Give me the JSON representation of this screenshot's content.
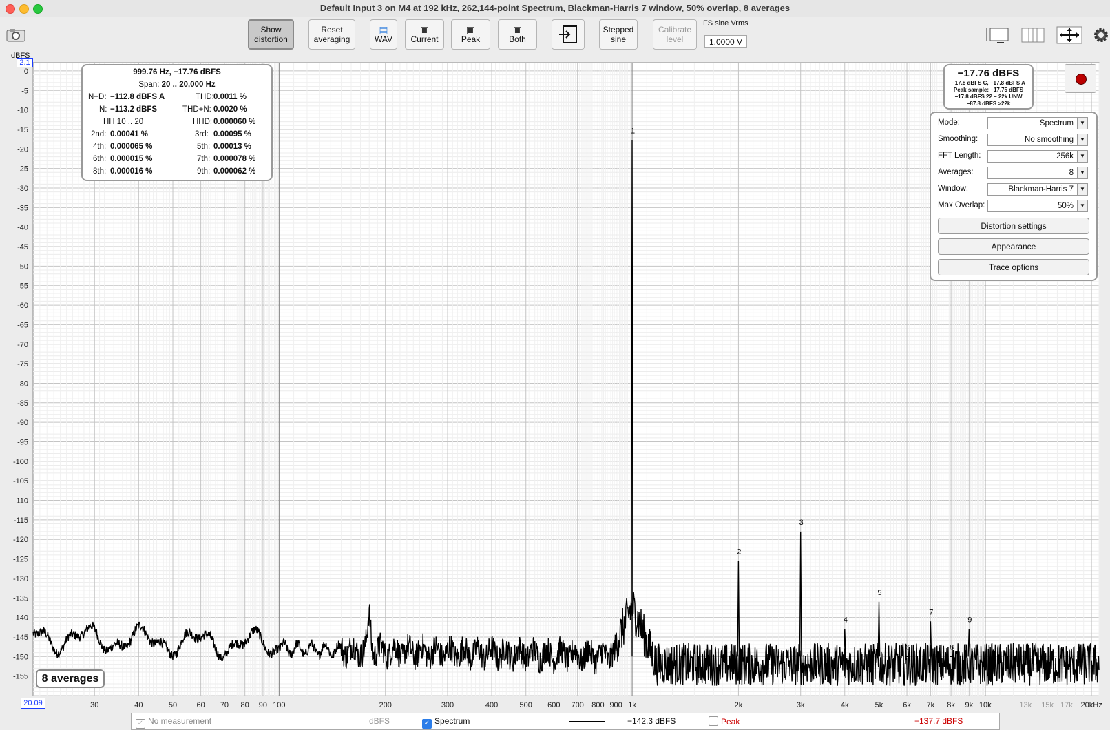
{
  "window": {
    "title": "Default Input 3 on M4 at 192 kHz, 262,144-point Spectrum, Blackman-Harris 7 window, 50% overlap, 8 averages"
  },
  "toolbar": {
    "show_distortion": [
      "Show",
      "distortion"
    ],
    "reset_averaging": [
      "Reset",
      "averaging"
    ],
    "wav": "WAV",
    "current": "Current",
    "peak": "Peak",
    "both": "Both",
    "stepped_sine": [
      "Stepped",
      "sine"
    ],
    "calibrate_level": [
      "Calibrate",
      "level"
    ],
    "fs_label": "FS sine Vrms",
    "fs_value": "1.0000 V"
  },
  "distortion": {
    "header": "999.76 Hz, −17.76 dBFS",
    "span_label": "Span:",
    "span": "20 .. 20,000 Hz",
    "rows": [
      [
        "N+D:",
        "−112.8 dBFS A",
        "THD:",
        "0.0011 %"
      ],
      [
        "N:",
        "−113.2 dBFS",
        "THD+N:",
        "0.0020 %"
      ],
      [
        "HH 10 .. 20",
        "",
        "HHD:",
        "0.000060 %"
      ],
      [
        "2nd:",
        "0.00041 %",
        "3rd:",
        "0.00095 %"
      ],
      [
        "4th:",
        "0.000065 %",
        "5th:",
        "0.00013 %"
      ],
      [
        "6th:",
        "0.000015 %",
        "7th:",
        "0.000078 %"
      ],
      [
        "8th:",
        "0.000016 %",
        "9th:",
        "0.000062 %"
      ]
    ]
  },
  "level_box": {
    "main": "−17.76 dBFS",
    "lines": [
      "−17.8 dBFS C, −17.8 dBFS A",
      "Peak sample: −17.75 dBFS",
      "−17.8 dBFS 22 – 22k UNW",
      "−87.8 dBFS >22k"
    ]
  },
  "controls": [
    {
      "label": "Mode:",
      "value": "Spectrum"
    },
    {
      "label": "Smoothing:",
      "value": "No  smoothing"
    },
    {
      "label": "FFT Length:",
      "value": "256k"
    },
    {
      "label": "Averages:",
      "value": "8"
    },
    {
      "label": "Window:",
      "value": "Blackman-Harris 7"
    },
    {
      "label": "Max Overlap:",
      "value": "50%"
    }
  ],
  "buttons": {
    "distortion_settings": "Distortion settings",
    "appearance": "Appearance",
    "trace_options": "Trace options"
  },
  "averages_badge": "8 averages",
  "axes": {
    "y_unit": "dBFS",
    "y_top_marker": "2.1",
    "x_left_marker": "20.09",
    "y_ticks": [
      "0",
      "-5",
      "-10",
      "-15",
      "-20",
      "-25",
      "-30",
      "-35",
      "-40",
      "-45",
      "-50",
      "-55",
      "-60",
      "-65",
      "-70",
      "-75",
      "-80",
      "-85",
      "-90",
      "-95",
      "-100",
      "-105",
      "-110",
      "-115",
      "-120",
      "-125",
      "-130",
      "-135",
      "-140",
      "-145",
      "-150",
      "-155"
    ],
    "x_ticks": [
      {
        "f": 30,
        "label": "30"
      },
      {
        "f": 40,
        "label": "40"
      },
      {
        "f": 50,
        "label": "50"
      },
      {
        "f": 60,
        "label": "60"
      },
      {
        "f": 70,
        "label": "70"
      },
      {
        "f": 80,
        "label": "80"
      },
      {
        "f": 90,
        "label": "90"
      },
      {
        "f": 100,
        "label": "100"
      },
      {
        "f": 200,
        "label": "200"
      },
      {
        "f": 300,
        "label": "300"
      },
      {
        "f": 400,
        "label": "400"
      },
      {
        "f": 500,
        "label": "500"
      },
      {
        "f": 600,
        "label": "600"
      },
      {
        "f": 700,
        "label": "700"
      },
      {
        "f": 800,
        "label": "800"
      },
      {
        "f": 900,
        "label": "900"
      },
      {
        "f": 1000,
        "label": "1k"
      },
      {
        "f": 2000,
        "label": "2k"
      },
      {
        "f": 3000,
        "label": "3k"
      },
      {
        "f": 4000,
        "label": "4k"
      },
      {
        "f": 5000,
        "label": "5k"
      },
      {
        "f": 6000,
        "label": "6k"
      },
      {
        "f": 7000,
        "label": "7k"
      },
      {
        "f": 8000,
        "label": "8k"
      },
      {
        "f": 9000,
        "label": "9k"
      },
      {
        "f": 10000,
        "label": "10k"
      },
      {
        "f": 13000,
        "label": "13k"
      },
      {
        "f": 15000,
        "label": "15k"
      },
      {
        "f": 17000,
        "label": "17k"
      },
      {
        "f": 20000,
        "label": "20kHz"
      }
    ]
  },
  "chart_data": {
    "type": "line",
    "xscale": "log",
    "xlim": [
      20.09,
      21000
    ],
    "ylim": [
      -160,
      2.1
    ],
    "ylabel": "dBFS",
    "noise_floor_db": -150,
    "peaks": [
      {
        "label": "1",
        "freq": 999.76,
        "db": -17.76
      },
      {
        "label": "2",
        "freq": 2000,
        "db": -125.5
      },
      {
        "label": "3",
        "freq": 3000,
        "db": -118
      },
      {
        "label": "4",
        "freq": 4000,
        "db": -143
      },
      {
        "label": "5",
        "freq": 5000,
        "db": -136
      },
      {
        "label": "6",
        "freq": 6000,
        "db": -150
      },
      {
        "label": "7",
        "freq": 7000,
        "db": -141
      },
      {
        "label": "8",
        "freq": 8000,
        "db": -150
      },
      {
        "label": "9",
        "freq": 9000,
        "db": -143
      }
    ],
    "hum_peak": {
      "freq": 180,
      "db": -140.5
    }
  },
  "legend": {
    "no_measurement": "No measurement",
    "unit": "dBFS",
    "spectrum": "Spectrum",
    "spectrum_value": "−142.3 dBFS",
    "peak": "Peak",
    "peak_value": "−137.7 dBFS",
    "peak_color": "#cc0000"
  }
}
